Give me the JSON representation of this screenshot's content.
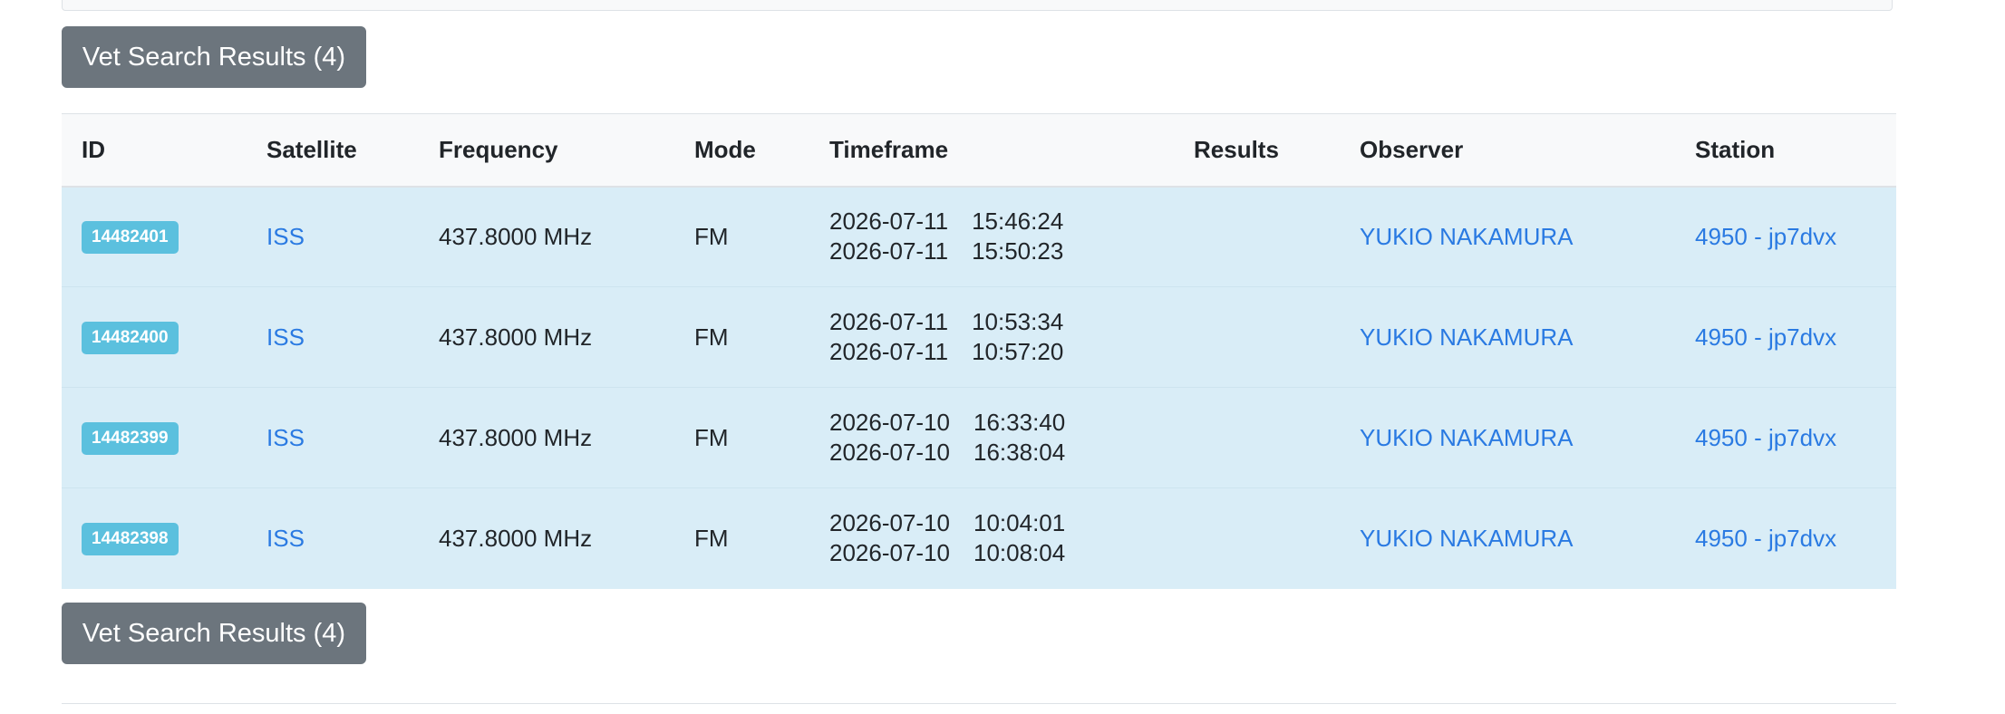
{
  "vet_button_label": "Vet Search Results (4)",
  "table": {
    "headers": {
      "id": "ID",
      "satellite": "Satellite",
      "frequency": "Frequency",
      "mode": "Mode",
      "timeframe": "Timeframe",
      "results": "Results",
      "observer": "Observer",
      "station": "Station"
    },
    "rows": [
      {
        "id": "14482401",
        "satellite": "ISS",
        "frequency": "437.8000 MHz",
        "mode": "FM",
        "start_date": "2026-07-11",
        "start_time": "15:46:24",
        "end_date": "2026-07-11",
        "end_time": "15:50:23",
        "results": "",
        "observer": "YUKIO NAKAMURA",
        "station": "4950 - jp7dvx"
      },
      {
        "id": "14482400",
        "satellite": "ISS",
        "frequency": "437.8000 MHz",
        "mode": "FM",
        "start_date": "2026-07-11",
        "start_time": "10:53:34",
        "end_date": "2026-07-11",
        "end_time": "10:57:20",
        "results": "",
        "observer": "YUKIO NAKAMURA",
        "station": "4950 - jp7dvx"
      },
      {
        "id": "14482399",
        "satellite": "ISS",
        "frequency": "437.8000 MHz",
        "mode": "FM",
        "start_date": "2026-07-10",
        "start_time": "16:33:40",
        "end_date": "2026-07-10",
        "end_time": "16:38:04",
        "results": "",
        "observer": "YUKIO NAKAMURA",
        "station": "4950 - jp7dvx"
      },
      {
        "id": "14482398",
        "satellite": "ISS",
        "frequency": "437.8000 MHz",
        "mode": "FM",
        "start_date": "2026-07-10",
        "start_time": "10:04:01",
        "end_date": "2026-07-10",
        "end_time": "10:08:04",
        "results": "",
        "observer": "YUKIO NAKAMURA",
        "station": "4950 - jp7dvx"
      }
    ]
  },
  "colors": {
    "button_bg": "#6c757d",
    "badge_bg": "#5bc0de",
    "row_bg": "#d9edf7",
    "link": "#2a7ae2",
    "header_bg": "#f8f9fa"
  }
}
